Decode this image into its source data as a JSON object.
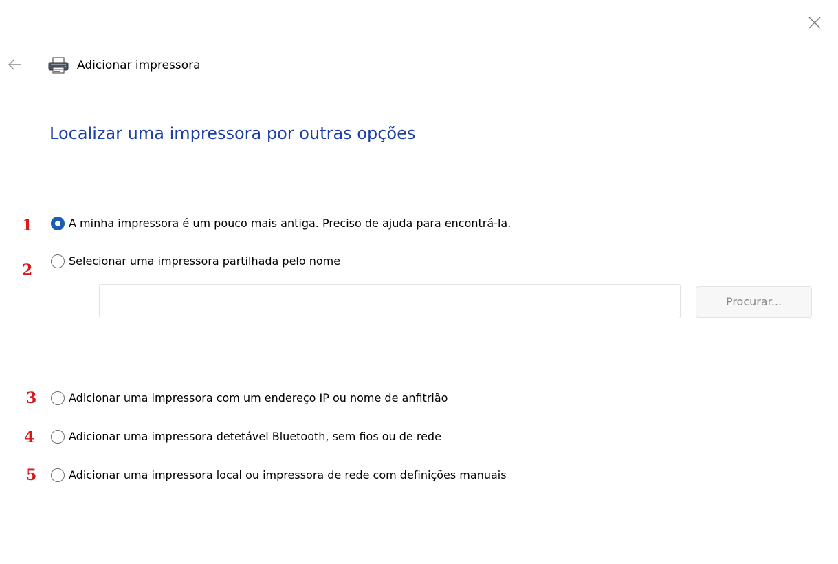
{
  "window": {
    "title": "Adicionar impressora",
    "close_icon": "close-icon",
    "back_icon": "back-arrow-icon",
    "app_icon": "printer-icon"
  },
  "page_title": "Localizar uma impressora por outras opções",
  "options": [
    {
      "marker": "1",
      "label": "A minha impressora é um pouco mais antiga. Preciso de ajuda para encontrá-la.",
      "selected": true
    },
    {
      "marker": "2",
      "label": "Selecionar uma impressora partilhada pelo nome",
      "selected": false
    },
    {
      "marker": "3",
      "label": "Adicionar uma impressora com um endereço IP ou nome de anfitrião",
      "selected": false
    },
    {
      "marker": "4",
      "label": "Adicionar uma impressora detetável Bluetooth, sem fios ou de rede",
      "selected": false
    },
    {
      "marker": "5",
      "label": "Adicionar uma impressora local ou impressora de rede com definições manuais",
      "selected": false
    }
  ],
  "shared_printer": {
    "value": "",
    "browse_label": "Procurar...",
    "browse_enabled": false
  },
  "colors": {
    "title": "#1c3fa8",
    "accent": "#1a5fb4",
    "marker": "#d7191c"
  }
}
